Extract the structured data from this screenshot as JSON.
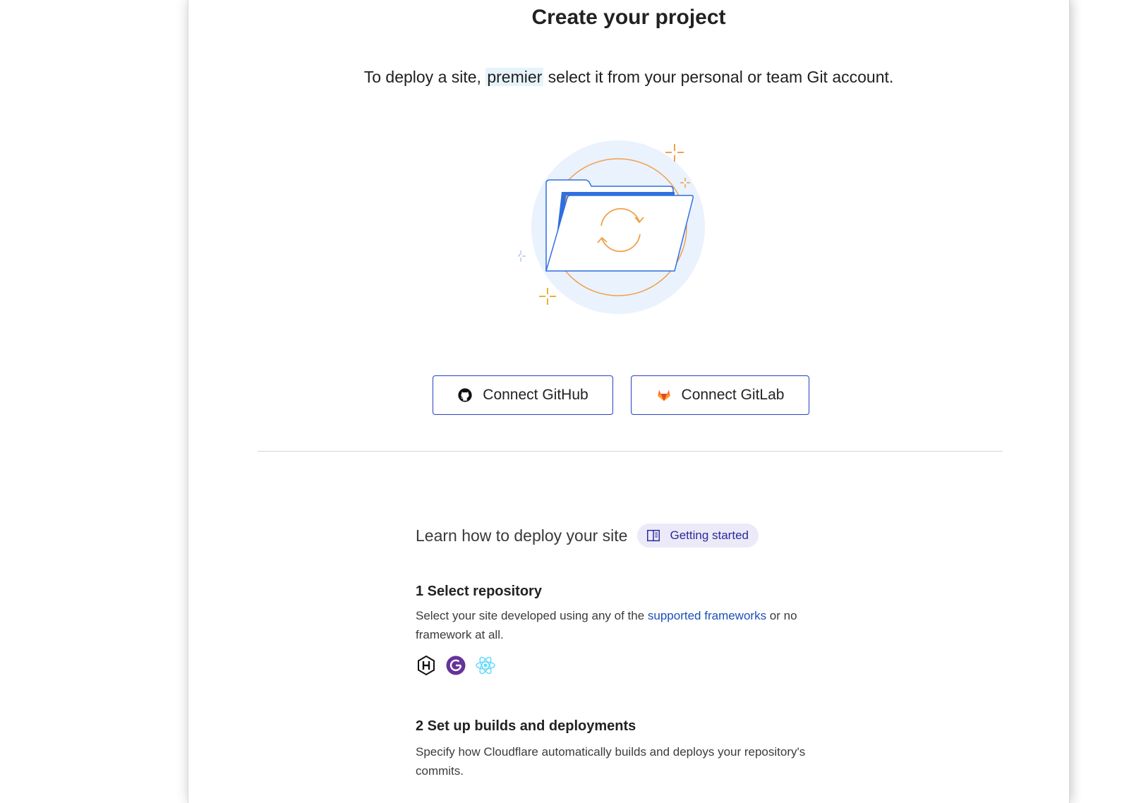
{
  "header": {
    "title": "Create your project",
    "subtitle_before": "To deploy a site, ",
    "subtitle_highlight": "premier",
    "subtitle_after": " select it from your personal or team Git account."
  },
  "buttons": {
    "github": {
      "label": "Connect GitHub",
      "icon": "github-icon"
    },
    "gitlab": {
      "label": "Connect GitLab",
      "icon": "gitlab-icon"
    }
  },
  "learn": {
    "text": "Learn how to deploy your site",
    "pill_label": "Getting started",
    "pill_icon": "book-icon"
  },
  "steps": [
    {
      "title": "1 Select repository",
      "desc_before": "Select your site developed using any of the ",
      "desc_link": "supported frameworks",
      "desc_after": " or no framework at all.",
      "framework_icons": [
        "hugo-icon",
        "gatsby-icon",
        "react-icon"
      ]
    },
    {
      "title": "2 Set up builds and deployments",
      "desc": "Specify how Cloudflare automatically builds and deploys your repository's commits."
    }
  ],
  "colors": {
    "button_border": "#2a3fbf",
    "link": "#1e4fb8",
    "pill_bg": "#eceaf9",
    "illustration_blue": "#2f6fe0",
    "illustration_orange": "#f0a04b",
    "illustration_circle": "#eaf2fd"
  }
}
